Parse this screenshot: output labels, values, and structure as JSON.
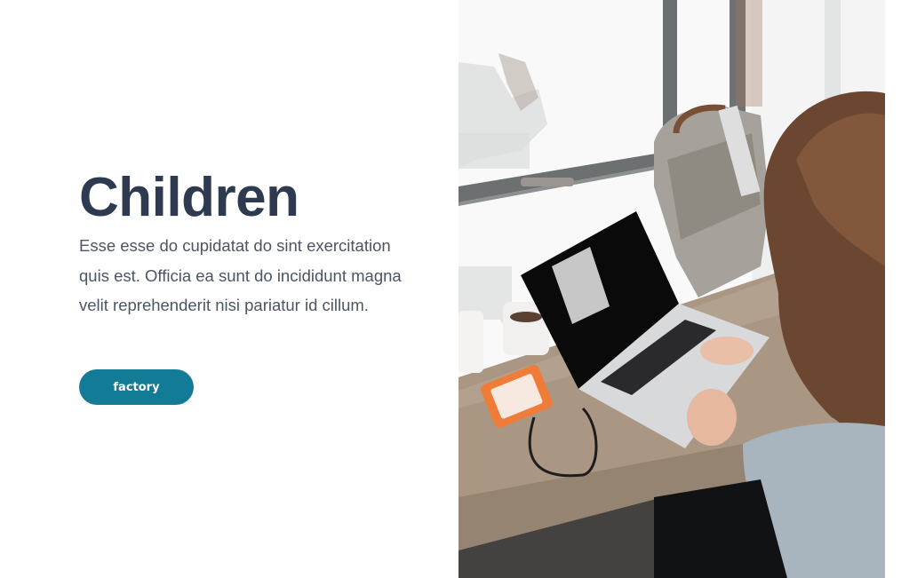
{
  "hero": {
    "title": "Children",
    "description": "Esse esse do cupidatat do sint exercitation quis est. Officia ea sunt do incididunt magna velit reprehenderit nisi pariatur id cillum.",
    "button_label": "factory"
  },
  "colors": {
    "title": "#2d3a50",
    "body_text": "#4b5563",
    "button_bg": "#127b96",
    "button_text": "#ffffff",
    "background": "#ffffff"
  }
}
